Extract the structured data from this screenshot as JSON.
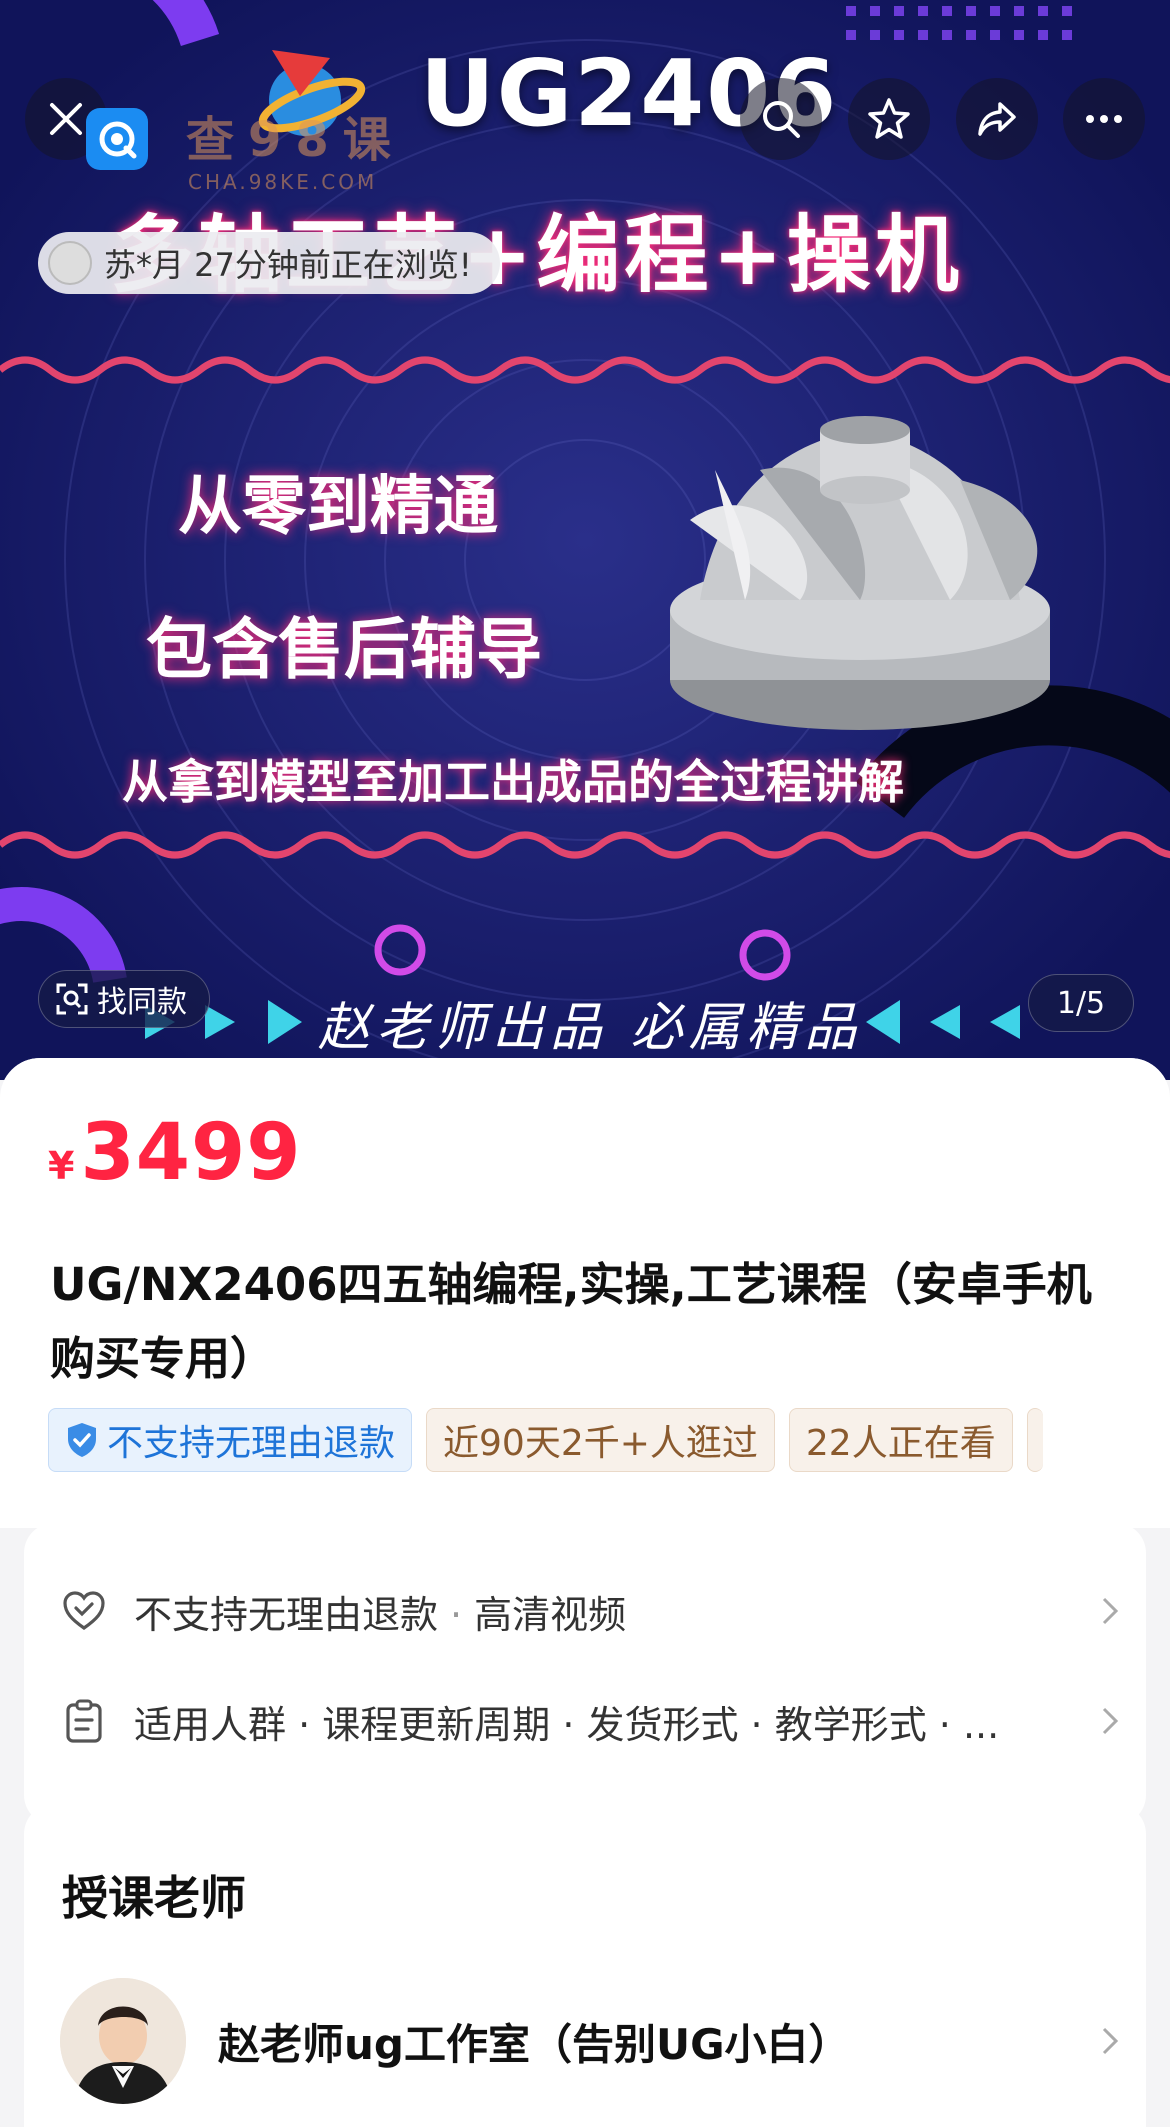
{
  "banner": {
    "title_ug": "UG2406",
    "title_main": "多轴工艺+编程+操机",
    "slogan1": "从零到精通",
    "slogan2": "包含售后辅导",
    "slogan3": "从拿到模型至加工出成品的全过程讲解",
    "signature": "赵老师出品 必属精品",
    "watermark": "查98课",
    "watermark_sub": "CHA.98KE.COM",
    "browse_notice": "苏*月 27分钟前正在浏览!",
    "find_same": "找同款",
    "page_indicator": "1/5"
  },
  "colors": {
    "price": "#ff2442",
    "banner_bg": "#141a63",
    "tag_blue": "#1e74d8"
  },
  "product": {
    "currency": "¥",
    "price": "3499",
    "title": "UG/NX2406四五轴编程,实操,工艺课程（安卓手机购买专用）",
    "tags": [
      "不支持无理由退款",
      "近90天2千+人逛过",
      "22人正在看"
    ]
  },
  "info": {
    "row1": {
      "a": "不支持无理由退款",
      "sep": "·",
      "b": "高清视频"
    },
    "row2": {
      "text": "适用人群 · 课程更新周期 · 发货形式 · 教学形式 · ..."
    }
  },
  "teacher": {
    "heading": "授课老师",
    "name": "赵老师ug工作室（告别UG小白）"
  }
}
